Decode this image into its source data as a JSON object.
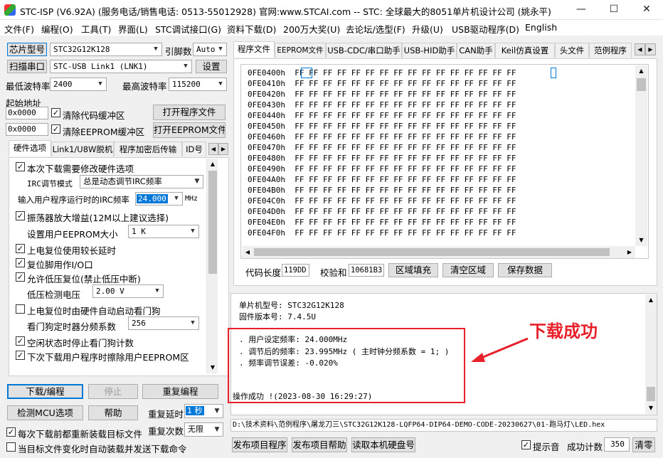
{
  "window": {
    "title": "STC-ISP (V6.92A) (服务电话/销售电话: 0513-55012928) 官网:www.STCAI.com  -- STC: 全球最大的8051单片机设计公司 (姚永平)",
    "minimize": "—",
    "maximize": "☐",
    "close": "✕"
  },
  "menu": [
    "文件(F)",
    "编程(O)",
    "工具(T)",
    "界面(L)",
    "STC调试接口(G)",
    "资料下载(D)",
    "200万大奖(U)",
    "去论坛/选型(F)",
    "升级(U)",
    "USB驱动程序(D)",
    "English"
  ],
  "left": {
    "chip_btn": "芯片型号",
    "chip_value": "STC32G12K128",
    "pins_label": "引脚数",
    "pins_value": "Auto",
    "scan_btn": "扫描串口",
    "port_value": "STC-USB Link1 (LNK1)",
    "settings_btn": "设置",
    "min_baud_label": "最低波特率",
    "min_baud": "2400",
    "max_baud_label": "最高波特率",
    "max_baud": "115200",
    "start_addr_label": "起始地址",
    "addr1": "0x0000",
    "clear_code": "清除代码缓冲区",
    "open_prog_btn": "打开程序文件",
    "addr2": "0x0000",
    "clear_eeprom": "清除EEPROM缓冲区",
    "open_eeprom_btn": "打开EEPROM文件",
    "tabs": [
      "硬件选项",
      "Link1/U8W脱机",
      "程序加密后传输",
      "ID号"
    ],
    "options": {
      "modify_hw": "本次下载需要修改硬件选项",
      "irc_mode_label": "IRC调节模式",
      "irc_mode": "总是动态调节IRC频率",
      "irc_freq_label": "输入用户程序运行时的IRC频率",
      "irc_freq": "24.000",
      "mhz": "MHz",
      "osc_gain": "振荡器放大增益(12M以上建议选择)",
      "eeprom_label": "设置用户EEPROM大小",
      "eeprom_size": "1   K",
      "power_delay": "上电复位使用较长延时",
      "reset_io": "复位脚用作I/O口",
      "lvr": "允许低压复位(禁止低压中断)",
      "lv_label": "低压检测电压",
      "lv_value": "2.00 V",
      "wdt_hw": "上电复位时由硬件自动启动看门狗",
      "wdt_div_label": "看门狗定时器分频系数",
      "wdt_div": "256",
      "idle_wdt": "空闲状态时停止看门狗计数",
      "erase_eeprom": "下次下载用户程序时擦除用户EEPROM区"
    },
    "download_btn": "下载/编程",
    "stop_btn": "停止",
    "reprogram_btn": "重复编程",
    "detect_btn": "检测MCU选项",
    "help_btn": "帮助",
    "delay_label": "重复延时",
    "delay_value": "1 秒",
    "reload_each": "每次下载前都重新装载目标文件",
    "count_label": "重复次数",
    "count_value": "无限",
    "auto_reload": "当目标文件变化时自动装载并发送下载命令"
  },
  "right": {
    "tabs": [
      "程序文件",
      "EEPROM文件",
      "USB-CDC/串口助手",
      "USB-HID助手",
      "CAN助手",
      "Keil仿真设置",
      "头文件",
      "范例程序"
    ],
    "hex_rows": [
      {
        "addr": "0FE0400h",
        "bytes": "FF FF FF FF FF FF FF FF FF FF FF FF FF FF FF FF"
      },
      {
        "addr": "0FE0410h",
        "bytes": "FF FF FF FF FF FF FF FF FF FF FF FF FF FF FF FF"
      },
      {
        "addr": "0FE0420h",
        "bytes": "FF FF FF FF FF FF FF FF FF FF FF FF FF FF FF FF"
      },
      {
        "addr": "0FE0430h",
        "bytes": "FF FF FF FF FF FF FF FF FF FF FF FF FF FF FF FF"
      },
      {
        "addr": "0FE0440h",
        "bytes": "FF FF FF FF FF FF FF FF FF FF FF FF FF FF FF FF"
      },
      {
        "addr": "0FE0450h",
        "bytes": "FF FF FF FF FF FF FF FF FF FF FF FF FF FF FF FF"
      },
      {
        "addr": "0FE0460h",
        "bytes": "FF FF FF FF FF FF FF FF FF FF FF FF FF FF FF FF"
      },
      {
        "addr": "0FE0470h",
        "bytes": "FF FF FF FF FF FF FF FF FF FF FF FF FF FF FF FF"
      },
      {
        "addr": "0FE0480h",
        "bytes": "FF FF FF FF FF FF FF FF FF FF FF FF FF FF FF FF"
      },
      {
        "addr": "0FE0490h",
        "bytes": "FF FF FF FF FF FF FF FF FF FF FF FF FF FF FF FF"
      },
      {
        "addr": "0FE04A0h",
        "bytes": "FF FF FF FF FF FF FF FF FF FF FF FF FF FF FF FF"
      },
      {
        "addr": "0FE04B0h",
        "bytes": "FF FF FF FF FF FF FF FF FF FF FF FF FF FF FF FF"
      },
      {
        "addr": "0FE04C0h",
        "bytes": "FF FF FF FF FF FF FF FF FF FF FF FF FF FF FF FF"
      },
      {
        "addr": "0FE04D0h",
        "bytes": "FF FF FF FF FF FF FF FF FF FF FF FF FF FF FF FF"
      },
      {
        "addr": "0FE04E0h",
        "bytes": "FF FF FF FF FF FF FF FF FF FF FF FF FF FF FF FF"
      },
      {
        "addr": "0FE04F0h",
        "bytes": "FF FF FF FF FF FF FF FF FF FF FF FF FF FF FF FF"
      }
    ],
    "code_len_label": "代码长度",
    "code_len": "119DD",
    "checksum_label": "校验和",
    "checksum": "10681B3",
    "fill_btn": "区域填充",
    "clear_btn": "清空区域",
    "save_btn": "保存数据",
    "log": {
      "chip": "单片机型号: STC32G12K128",
      "fw": "固件版本号: 7.4.5U",
      "l1": ". 用户设定频率: 24.000MHz",
      "l2": ". 调节后的频率: 23.995MHz ( 主时钟分频系数 = 1; )",
      "l3": ". 频率调节误差: -0.020%",
      "ok": "操作成功 !(2023-08-30 16:29:27)"
    },
    "annotation": "下载成功",
    "path": "D:\\技术资料\\范例程序\\屠龙刀三\\STC32G12K128-LQFP64-DIP64-DEMO-CODE-20230627\\01-跑马灯\\LED.hex",
    "publish_prog_btn": "发布项目程序",
    "publish_help_btn": "发布项目帮助",
    "read_sn_btn": "读取本机硬盘号",
    "beep": "提示音",
    "success_count_label": "成功计数",
    "success_count": "350",
    "clear_count_btn": "清零"
  },
  "colors": {
    "annotation_red": "#e8202a",
    "selection_blue": "#0078d7"
  }
}
